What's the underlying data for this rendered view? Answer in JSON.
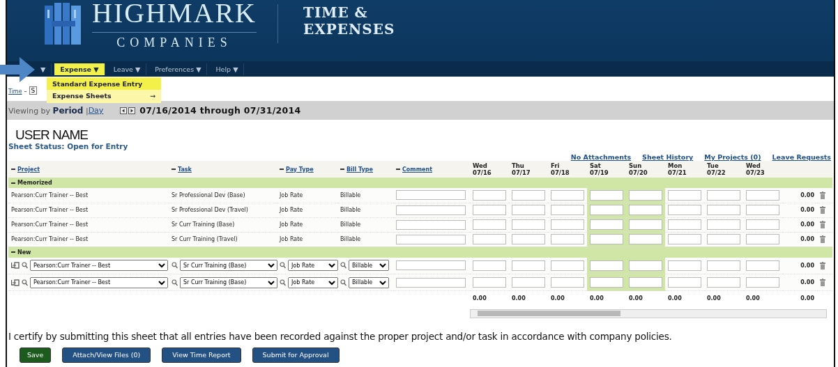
{
  "header": {
    "brand": "HIGHMARK",
    "brand_sub": "COMPANIES",
    "app_title": [
      "TIME &",
      "EXPENSES"
    ]
  },
  "nav": {
    "items": [
      {
        "caret": "▼",
        "selected": false
      },
      {
        "label": "Expense",
        "caret": "▼",
        "selected": true
      },
      {
        "label": "Leave",
        "caret": "▼",
        "selected": false
      },
      {
        "label": "Preferences",
        "caret": "▼",
        "selected": false
      },
      {
        "label": "Help",
        "caret": "▼",
        "selected": false
      }
    ],
    "dropdown": [
      {
        "label": "Standard Expense Entry",
        "selected": true
      },
      {
        "label": "Expense Sheets",
        "arrow": "→",
        "selected": false
      }
    ]
  },
  "breadcrumb": {
    "link": "Time",
    "separator": "–",
    "current": "S"
  },
  "period_bar": {
    "viewing": "Viewing by",
    "mode": "Period",
    "separator": "|",
    "alt_mode": "Day",
    "range": "07/16/2014 through 07/31/2014"
  },
  "user_name": "USER NAME",
  "sheet_status": "Sheet Status: Open for Entry",
  "links": [
    "No Attachments",
    "Sheet History",
    "My Projects (0)",
    "Leave Requests"
  ],
  "table": {
    "columns": [
      "Project",
      "Task",
      "Pay Type",
      "Bill Type",
      "Comment"
    ],
    "days": [
      {
        "day": "Wed",
        "date": "07/16",
        "weekend": false
      },
      {
        "day": "Thu",
        "date": "07/17",
        "weekend": false
      },
      {
        "day": "Fri",
        "date": "07/18",
        "weekend": false
      },
      {
        "day": "Sat",
        "date": "07/19",
        "weekend": true
      },
      {
        "day": "Sun",
        "date": "07/20",
        "weekend": true
      },
      {
        "day": "Mon",
        "date": "07/21",
        "weekend": false
      },
      {
        "day": "Tue",
        "date": "07/22",
        "weekend": false
      },
      {
        "day": "Wed",
        "date": "07/23",
        "weekend": false
      }
    ],
    "groups": [
      {
        "label": "Memorized",
        "kind": "memorized",
        "rows": [
          {
            "project": "Pearson:Curr Trainer -- Best",
            "task": "Sr Professional Dev (Base)",
            "pay_type": "Job Rate",
            "bill_type": "Billable",
            "total": "0.00"
          },
          {
            "project": "Pearson:Curr Trainer -- Best",
            "task": "Sr Professional Dev (Travel)",
            "pay_type": "Job Rate",
            "bill_type": "Billable",
            "total": "0.00"
          },
          {
            "project": "Pearson:Curr Trainer -- Best",
            "task": "Sr Curr Training (Base)",
            "pay_type": "Job Rate",
            "bill_type": "Billable",
            "total": "0.00"
          },
          {
            "project": "Pearson:Curr Trainer -- Best",
            "task": "Sr Curr Training (Travel)",
            "pay_type": "Job Rate",
            "bill_type": "Billable",
            "total": "0.00"
          }
        ]
      },
      {
        "label": "New",
        "kind": "new",
        "rows": [
          {
            "project": "Pearson:Curr Trainer -- Best",
            "task": "Sr Curr Training (Base)",
            "pay_type": "Job Rate",
            "bill_type": "Billable",
            "total": "0.00"
          },
          {
            "project": "Pearson:Curr Trainer -- Best",
            "task": "Sr Curr Training (Base)",
            "pay_type": "Job Rate",
            "bill_type": "Billable",
            "total": "0.00"
          }
        ]
      }
    ],
    "day_totals": [
      "0.00",
      "0.00",
      "0.00",
      "0.00",
      "0.00",
      "0.00",
      "0.00",
      "0.00"
    ],
    "grand_total": "0.00"
  },
  "certification": "I certify by submitting this sheet that all entries have been recorded against the proper project and/or task in accordance with company policies.",
  "buttons": [
    {
      "label": "Save",
      "kind": "save"
    },
    {
      "label": "Attach/View Files (0)",
      "kind": "action"
    },
    {
      "label": "View Time Report",
      "kind": "action"
    },
    {
      "label": "Submit for Approval",
      "kind": "action"
    }
  ]
}
